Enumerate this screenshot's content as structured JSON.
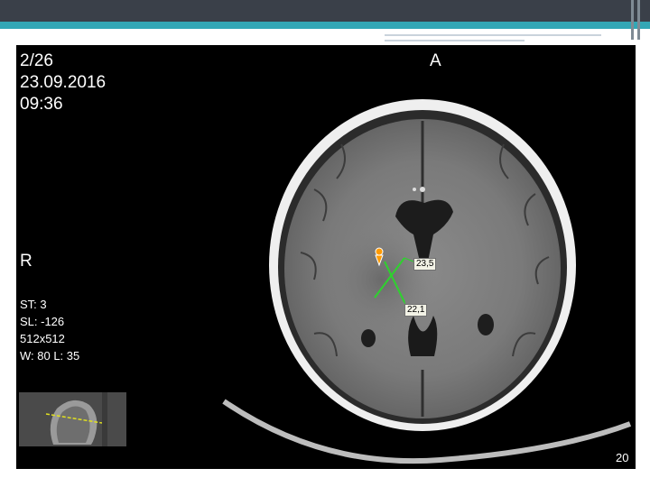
{
  "overlay": {
    "image_index": "2/26",
    "date": "23.09.2016",
    "time": "09:36",
    "orientation_top": "A",
    "orientation_left": "R",
    "slice_thickness": "ST: 3",
    "slice_location": "SL: -126",
    "matrix": "512x512",
    "window_level": "W: 80 L: 35",
    "corner_number": "20"
  },
  "measurements": [
    {
      "label": "23,5"
    },
    {
      "label": "22,1"
    }
  ],
  "colors": {
    "slide_header": "#3a4049",
    "accent": "#33a7b5",
    "measure_line": "#2fd12f",
    "marker": "#ff9a00",
    "scout_line": "#e0e020"
  }
}
